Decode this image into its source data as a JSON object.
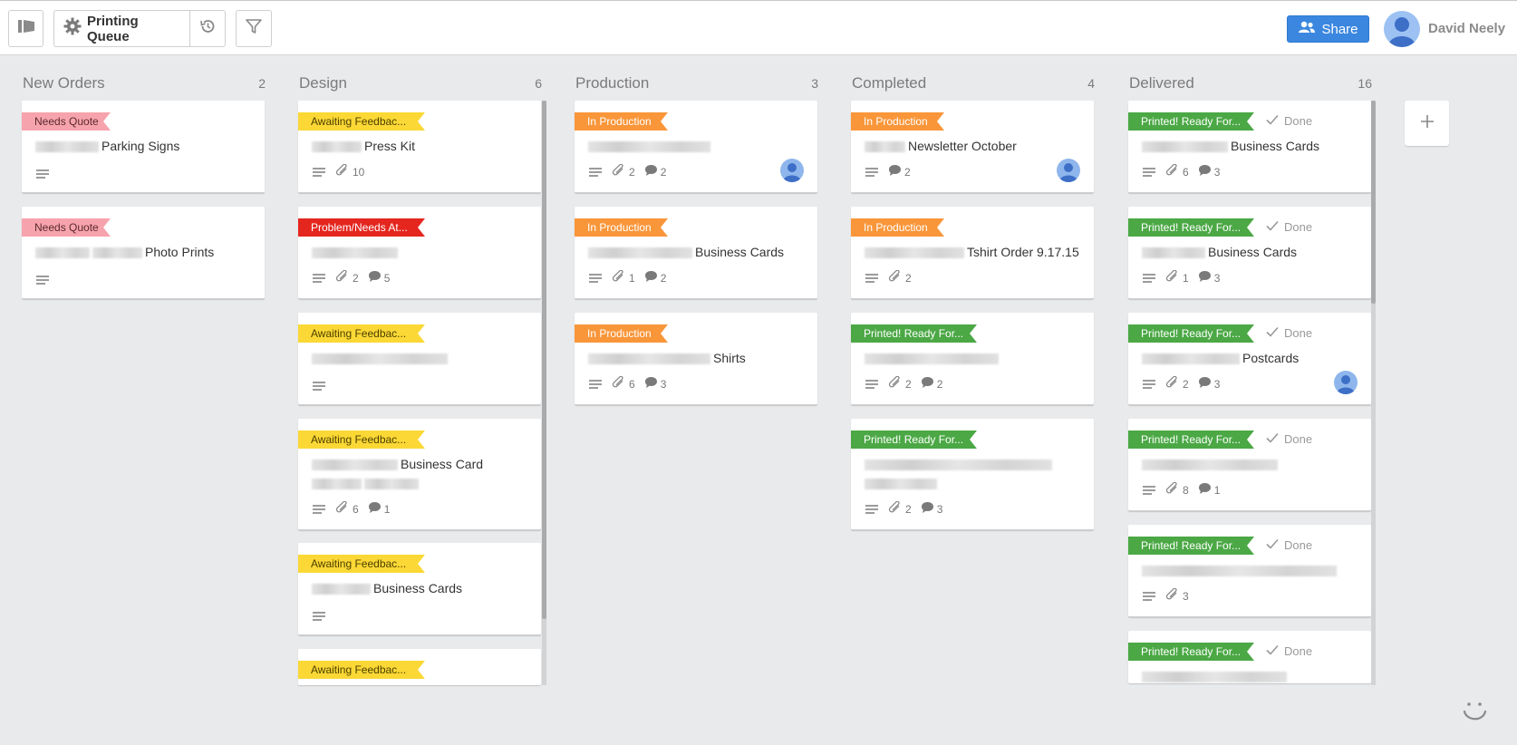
{
  "header": {
    "board_name": "Printing Queue",
    "share_label": "Share",
    "user_name": "David Neely"
  },
  "colors": {
    "needs_quote": "#f7a3ad",
    "awaiting": "#fbd835",
    "problem": "#e4261f",
    "in_production": "#f9963a",
    "printed": "#4ba845",
    "share": "#3b87e0"
  },
  "lists": [
    {
      "title": "New Orders",
      "count": "2",
      "cards": [
        {
          "label": "Needs Quote",
          "label_type": "needs_quote",
          "title": "Parking Signs",
          "blur": [
            70
          ],
          "desc": true
        },
        {
          "label": "Needs Quote",
          "label_type": "needs_quote",
          "title": "Photo Prints",
          "blur": [
            60,
            55
          ],
          "desc": true
        }
      ]
    },
    {
      "title": "Design",
      "count": "6",
      "cards": [
        {
          "label": "Awaiting Feedbac...",
          "label_type": "awaiting",
          "title": "Press Kit",
          "blur": [
            55
          ],
          "desc": true,
          "attach": "10"
        },
        {
          "label": "Problem/Needs At...",
          "label_type": "problem",
          "title": "",
          "blur": [
            95
          ],
          "desc": true,
          "attach": "2",
          "comments": "5"
        },
        {
          "label": "Awaiting Feedbac...",
          "label_type": "awaiting",
          "title": "",
          "blur": [
            150
          ],
          "desc": true
        },
        {
          "label": "Awaiting Feedbac...",
          "label_type": "awaiting",
          "title": "Business Card",
          "blur": [
            95
          ],
          "blur_after": [
            55,
            60
          ],
          "desc": true,
          "attach": "6",
          "comments": "1"
        },
        {
          "label": "Awaiting Feedbac...",
          "label_type": "awaiting",
          "title": "Business Cards",
          "blur": [
            65
          ],
          "desc": true
        },
        {
          "label": "Awaiting Feedbac...",
          "label_type": "awaiting",
          "title": "",
          "blur": [],
          "partial": true
        }
      ]
    },
    {
      "title": "Production",
      "count": "3",
      "cards": [
        {
          "label": "In Production",
          "label_type": "in_production",
          "title": "",
          "blur": [
            135
          ],
          "desc": true,
          "attach": "2",
          "comments": "2",
          "avatar": true
        },
        {
          "label": "In Production",
          "label_type": "in_production",
          "title": "Business Cards",
          "blur": [
            115
          ],
          "desc": true,
          "attach": "1",
          "comments": "2"
        },
        {
          "label": "In Production",
          "label_type": "in_production",
          "title": "Shirts",
          "blur": [
            135
          ],
          "desc": true,
          "attach": "6",
          "comments": "3"
        }
      ]
    },
    {
      "title": "Completed",
      "count": "4",
      "cards": [
        {
          "label": "In Production",
          "label_type": "in_production",
          "title": "Newsletter October",
          "blur": [
            45
          ],
          "desc": true,
          "comments": "2",
          "avatar": true
        },
        {
          "label": "In Production",
          "label_type": "in_production",
          "title": "Tshirt Order 9.17.15",
          "blur": [
            110
          ],
          "desc": true,
          "attach": "2"
        },
        {
          "label": "Printed! Ready For...",
          "label_type": "printed",
          "title": "",
          "blur": [
            148
          ],
          "desc": true,
          "attach": "2",
          "comments": "2"
        },
        {
          "label": "Printed! Ready For...",
          "label_type": "printed",
          "title": "",
          "blur": [
            207
          ],
          "blur2": [
            80
          ],
          "desc": true,
          "attach": "2",
          "comments": "3"
        }
      ]
    },
    {
      "title": "Delivered",
      "count": "16",
      "cards": [
        {
          "label": "Printed! Ready For...",
          "label_type": "printed",
          "done": "Done",
          "title": "Business Cards",
          "blur": [
            95
          ],
          "desc": true,
          "attach": "6",
          "comments": "3"
        },
        {
          "label": "Printed! Ready For...",
          "label_type": "printed",
          "done": "Done",
          "title": "Business Cards",
          "blur": [
            70
          ],
          "desc": true,
          "attach": "1",
          "comments": "3"
        },
        {
          "label": "Printed! Ready For...",
          "label_type": "printed",
          "done": "Done",
          "title": "Postcards",
          "blur": [
            108
          ],
          "desc": true,
          "attach": "2",
          "comments": "3",
          "avatar": true
        },
        {
          "label": "Printed! Ready For...",
          "label_type": "printed",
          "done": "Done",
          "title": "",
          "blur": [
            150
          ],
          "desc": true,
          "attach": "8",
          "comments": "1"
        },
        {
          "label": "Printed! Ready For...",
          "label_type": "printed",
          "done": "Done",
          "title": "",
          "blur": [
            215
          ],
          "desc": true,
          "attach": "3"
        },
        {
          "label": "Printed! Ready For...",
          "label_type": "printed",
          "done": "Done",
          "title": "",
          "blur": [
            160
          ],
          "partial": true
        }
      ]
    }
  ]
}
